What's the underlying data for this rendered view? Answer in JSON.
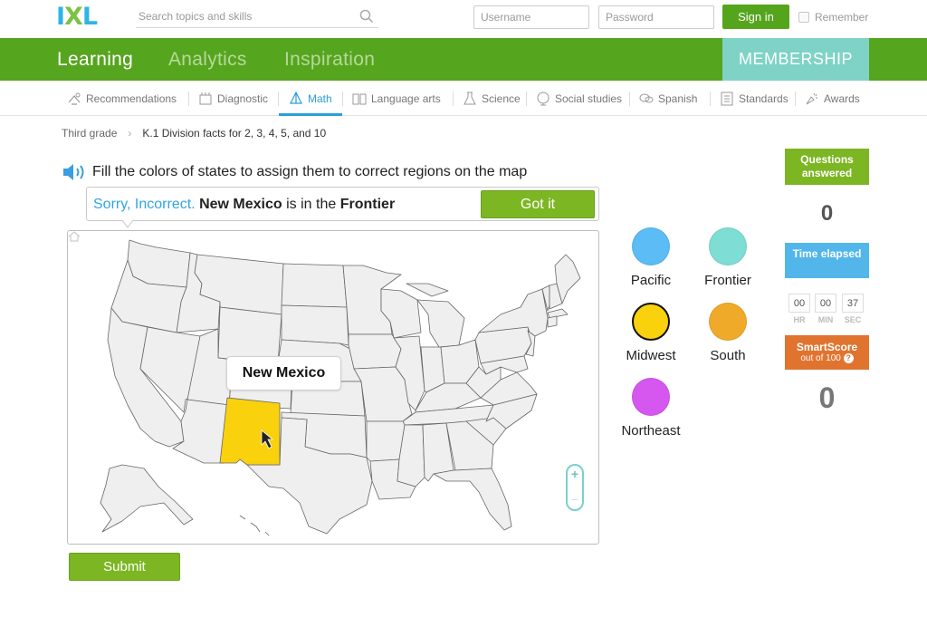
{
  "header": {
    "logo": [
      "I",
      "X",
      "L"
    ],
    "logo_colors": [
      "#2fb4e6",
      "#7cc243",
      "#2fb4e6"
    ],
    "search_placeholder": "Search topics and skills",
    "username_placeholder": "Username",
    "password_placeholder": "Password",
    "signin_label": "Sign in",
    "remember_label": "Remember"
  },
  "nav": {
    "items": [
      "Learning",
      "Analytics",
      "Inspiration"
    ],
    "membership": "MEMBERSHIP"
  },
  "subjects": {
    "items": [
      "Recommendations",
      "Diagnostic",
      "Math",
      "Language arts",
      "Science",
      "Social studies",
      "Spanish",
      "Standards",
      "Awards"
    ],
    "active": "Math"
  },
  "breadcrumb": {
    "grade": "Third grade",
    "skill": "K.1 Division facts for 2, 3, 4, 5, and 10"
  },
  "question": {
    "prompt": "Fill the colors of states to assign them to correct regions on the map"
  },
  "feedback": {
    "sorry": "Sorry, Incorrect.",
    "state": "New Mexico",
    "middle": "is in the",
    "region": "Frontier",
    "button": "Got it"
  },
  "map": {
    "tooltip": "New Mexico",
    "zoom_in": "+",
    "zoom_out": "−"
  },
  "regions": [
    {
      "label": "Pacific",
      "color": "#5bbcf6",
      "selected": false
    },
    {
      "label": "Frontier",
      "color": "#7eddd4",
      "selected": false
    },
    {
      "label": "Midwest",
      "color": "#f9d10c",
      "selected": true
    },
    {
      "label": "South",
      "color": "#f0aa2a",
      "selected": false
    },
    {
      "label": "Northeast",
      "color": "#d657f0",
      "selected": false
    }
  ],
  "stats": {
    "questions_label": "Questions answered",
    "questions_value": "0",
    "time_label": "Time elapsed",
    "hr": "00",
    "min": "00",
    "sec": "37",
    "hr_label": "HR",
    "min_label": "MIN",
    "sec_label": "SEC",
    "smartscore_label": "SmartScore",
    "smartscore_sub": "out of 100",
    "smartscore_help": "?",
    "smartscore_value": "0"
  },
  "submit_label": "Submit"
}
